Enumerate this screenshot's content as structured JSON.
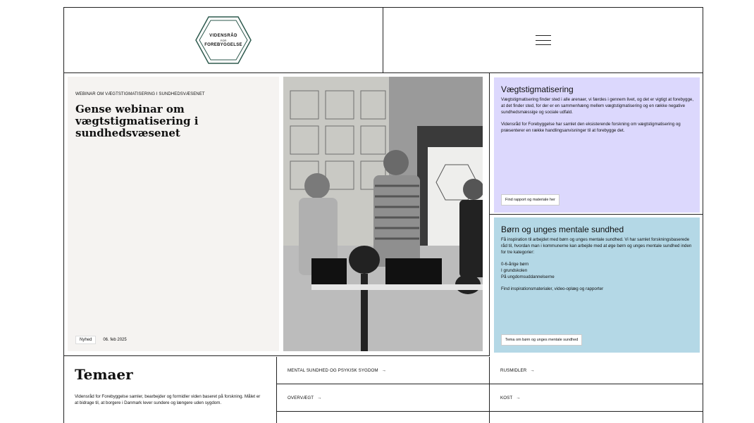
{
  "logo": {
    "line1": "VIDENSRÅD",
    "line2": "FOR",
    "line3": "FOREBYGGELSE"
  },
  "hero": {
    "kicker": "WEBINAR OM VÆGTSTIGMATISERING I SUNDHEDSVÆSENET",
    "title": "Gense webinar om vægtstigmatisering i sundhedsvæsenet",
    "tag": "Nyhed",
    "date": "06. feb 2025"
  },
  "panels": {
    "weight": {
      "title": "Vægtstigmatisering",
      "p1": "Vægtstigmatisering finder sted i alle arenaer, vi færdes i gennem livet, og det er vigtigt at forebygge, at det finder sted, for der er en sammenhæng mellem vægtstigmatisering og en række negative sundhedsmæssige og sociale udfald.",
      "p2": "Vidensråd for Forebyggelse har samlet den eksisterende forskning om vægtstigmatisering og præsenterer en række handlingsanvisninger til at forebygge det.",
      "button": "Find rapport og materiale her",
      "color": "#dcd8fd"
    },
    "children": {
      "title": "Børn og unges mentale sundhed",
      "p1": "Få inspiration til arbejdet med børn og unges mentale sundhed. Vi har samlet forskningsbaserede råd til, hvordan man i kommunerne kan arbejde med at øge børn og unges mentale sundhed inden for tre kategorier:",
      "list": [
        "0-6-årige børn",
        "I grundskolen",
        "På ungdomsuddannelserne"
      ],
      "p2": "Find inspirationsmaterialer, video-oplæg og rapporter",
      "button": "Tema om børn og unges mentale sundhed",
      "color": "#b4d8e6"
    }
  },
  "themes": {
    "title": "Temaer",
    "description": "Vidensråd for Forebyggelse samler, bearbejder og formidler viden baseret på forskning. Målet er at bidrage til, at borgere i Danmark lever sundere og længere uden sygdom.",
    "items": [
      "MENTAL SUNDHED OG PSYKISK SYGDOM",
      "OVERVÆGT",
      "RUSMIDLER",
      "KOST"
    ],
    "arrow": "→"
  }
}
